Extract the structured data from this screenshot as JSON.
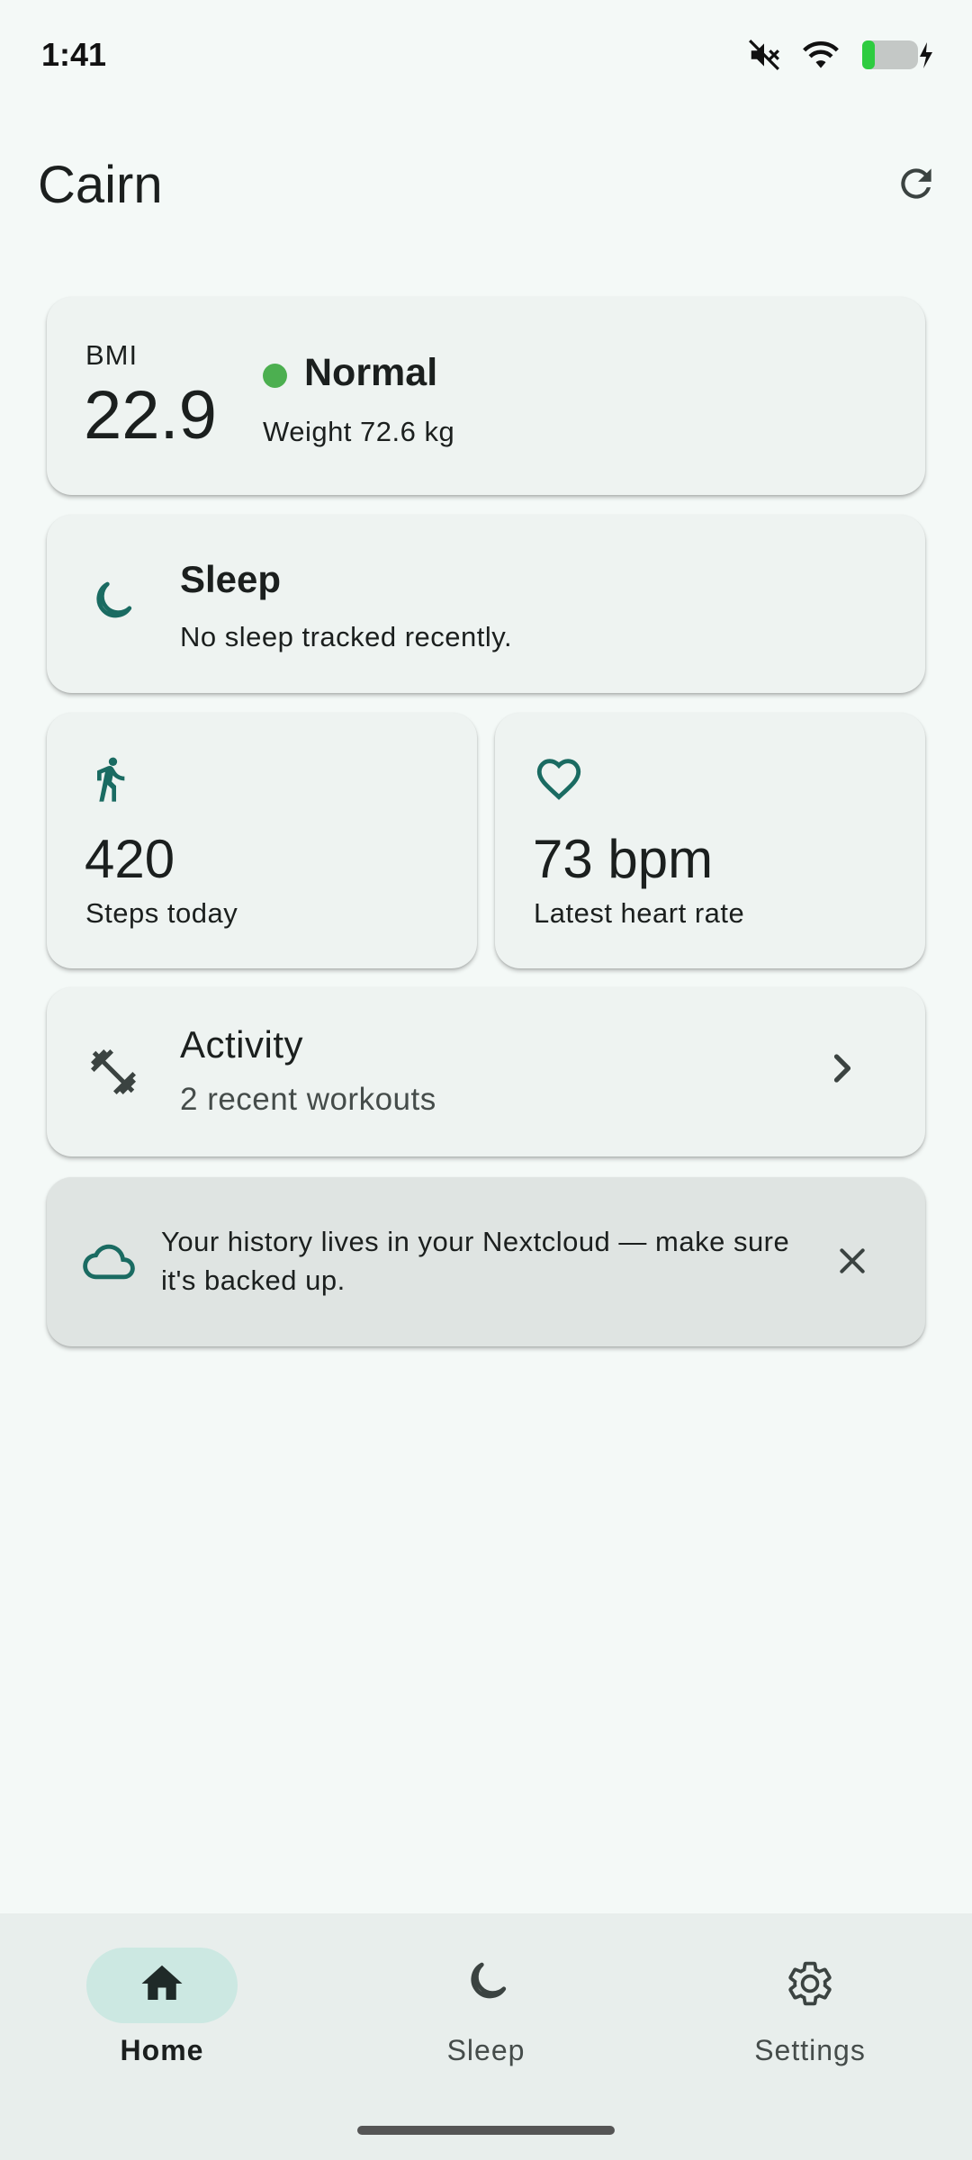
{
  "status_bar": {
    "time": "1:41"
  },
  "app_bar": {
    "title": "Cairn"
  },
  "bmi": {
    "label": "BMI",
    "value": "22.9",
    "status": "Normal",
    "status_color": "#4caf50",
    "weight": "Weight 72.6 kg"
  },
  "sleep": {
    "title": "Sleep",
    "subtitle": "No sleep tracked recently."
  },
  "steps": {
    "value": "420",
    "label": "Steps today"
  },
  "heart": {
    "value": "73 bpm",
    "label": "Latest heart rate"
  },
  "activity": {
    "title": "Activity",
    "subtitle": "2 recent workouts"
  },
  "banner": {
    "text": "Your history lives in your Nextcloud — make sure it's backed up."
  },
  "nav": {
    "items": [
      {
        "label": "Home",
        "icon": "home-icon",
        "active": true
      },
      {
        "label": "Sleep",
        "icon": "moon-icon",
        "active": false
      },
      {
        "label": "Settings",
        "icon": "gear-icon",
        "active": false
      }
    ]
  },
  "colors": {
    "accent": "#1a6b62",
    "background": "#f4f9f7",
    "card": "#eef3f1"
  }
}
